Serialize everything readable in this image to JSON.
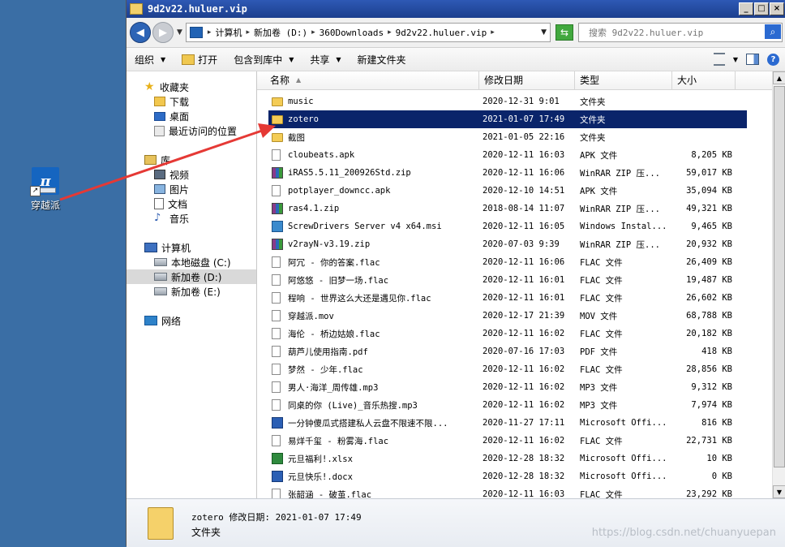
{
  "desktop": {
    "icon_label": "穿越派",
    "icon_glyph": "π"
  },
  "window": {
    "title": "9d2v22.huluer.vip",
    "buttons": {
      "minimize": "_",
      "maximize": "□",
      "close": "×"
    }
  },
  "address": {
    "segments": [
      "计算机",
      "新加卷 (D:)",
      "360Downloads",
      "9d2v22.huluer.vip"
    ],
    "search_placeholder": "搜索 9d2v22.huluer.vip"
  },
  "toolbar": {
    "organize": "组织",
    "open": "打开",
    "include_library": "包含到库中",
    "share": "共享",
    "new_folder": "新建文件夹"
  },
  "nav": {
    "favorites": "收藏夹",
    "downloads": "下载",
    "desktop": "桌面",
    "recent": "最近访问的位置",
    "libraries": "库",
    "videos": "视频",
    "pictures": "图片",
    "documents": "文档",
    "music": "音乐",
    "computer": "计算机",
    "drive_c": "本地磁盘 (C:)",
    "drive_d": "新加卷 (D:)",
    "drive_e": "新加卷 (E:)",
    "network": "网络"
  },
  "columns": {
    "name": "名称",
    "date": "修改日期",
    "type": "类型",
    "size": "大小"
  },
  "files": [
    {
      "name": "music",
      "date": "2020-12-31 9:01",
      "type": "文件夹",
      "size": "",
      "icon": "folder"
    },
    {
      "name": "zotero",
      "date": "2021-01-07 17:49",
      "type": "文件夹",
      "size": "",
      "icon": "folder",
      "selected": true
    },
    {
      "name": "截图",
      "date": "2021-01-05 22:16",
      "type": "文件夹",
      "size": "",
      "icon": "folder"
    },
    {
      "name": "cloubeats.apk",
      "date": "2020-12-11 16:03",
      "type": "APK 文件",
      "size": "8,205 KB",
      "icon": "file"
    },
    {
      "name": "iRAS5.5.11_200926Std.zip",
      "date": "2020-12-11 16:06",
      "type": "WinRAR ZIP 压...",
      "size": "59,017 KB",
      "icon": "rar"
    },
    {
      "name": "potplayer_downcc.apk",
      "date": "2020-12-10 14:51",
      "type": "APK 文件",
      "size": "35,094 KB",
      "icon": "file"
    },
    {
      "name": "ras4.1.zip",
      "date": "2018-08-14 11:07",
      "type": "WinRAR ZIP 压...",
      "size": "49,321 KB",
      "icon": "rar"
    },
    {
      "name": "ScrewDrivers Server v4 x64.msi",
      "date": "2020-12-11 16:05",
      "type": "Windows Instal...",
      "size": "9,465 KB",
      "icon": "msi"
    },
    {
      "name": "v2rayN-v3.19.zip",
      "date": "2020-07-03 9:39",
      "type": "WinRAR ZIP 压...",
      "size": "20,932 KB",
      "icon": "rar"
    },
    {
      "name": "阿冗 - 你的答案.flac",
      "date": "2020-12-11 16:06",
      "type": "FLAC 文件",
      "size": "26,409 KB",
      "icon": "file"
    },
    {
      "name": "阿悠悠 - 旧梦一场.flac",
      "date": "2020-12-11 16:01",
      "type": "FLAC 文件",
      "size": "19,487 KB",
      "icon": "file"
    },
    {
      "name": "程响 - 世界这么大还是遇见你.flac",
      "date": "2020-12-11 16:01",
      "type": "FLAC 文件",
      "size": "26,602 KB",
      "icon": "file"
    },
    {
      "name": "穿越派.mov",
      "date": "2020-12-17 21:39",
      "type": "MOV 文件",
      "size": "68,788 KB",
      "icon": "file"
    },
    {
      "name": "海伦 - 桥边姑娘.flac",
      "date": "2020-12-11 16:02",
      "type": "FLAC 文件",
      "size": "20,182 KB",
      "icon": "file"
    },
    {
      "name": "葫芦儿使用指南.pdf",
      "date": "2020-07-16 17:03",
      "type": "PDF 文件",
      "size": "418 KB",
      "icon": "file"
    },
    {
      "name": "梦然 - 少年.flac",
      "date": "2020-12-11 16:02",
      "type": "FLAC 文件",
      "size": "28,856 KB",
      "icon": "file"
    },
    {
      "name": "男人·海洋_周传雄.mp3",
      "date": "2020-12-11 16:02",
      "type": "MP3 文件",
      "size": "9,312 KB",
      "icon": "file"
    },
    {
      "name": "同桌的你 (Live)_音乐热搜.mp3",
      "date": "2020-12-11 16:02",
      "type": "MP3 文件",
      "size": "7,974 KB",
      "icon": "file"
    },
    {
      "name": "一分钟傻瓜式搭建私人云盘不限速不限...",
      "date": "2020-11-27 17:11",
      "type": "Microsoft Offi...",
      "size": "816 KB",
      "icon": "word"
    },
    {
      "name": "易烊千玺 - 粉雾海.flac",
      "date": "2020-12-11 16:02",
      "type": "FLAC 文件",
      "size": "22,731 KB",
      "icon": "file"
    },
    {
      "name": "元旦福利!.xlsx",
      "date": "2020-12-28 18:32",
      "type": "Microsoft Offi...",
      "size": "10 KB",
      "icon": "excel"
    },
    {
      "name": "元旦快乐!.docx",
      "date": "2020-12-28 18:32",
      "type": "Microsoft Offi...",
      "size": "0 KB",
      "icon": "word"
    },
    {
      "name": "张韶涵 - 破茧.flac",
      "date": "2020-12-11 16:03",
      "type": "FLAC 文件",
      "size": "23,292 KB",
      "icon": "file"
    }
  ],
  "details": {
    "line1": "zotero 修改日期: 2021-01-07 17:49",
    "line2": "文件夹"
  },
  "watermark": "https://blog.csdn.net/chuanyuepan",
  "colors": {
    "selection": "#0a246a",
    "titlebar": "#1c3f8d",
    "desktop": "#3a6ea5",
    "annotation_arrow": "#e53935"
  }
}
